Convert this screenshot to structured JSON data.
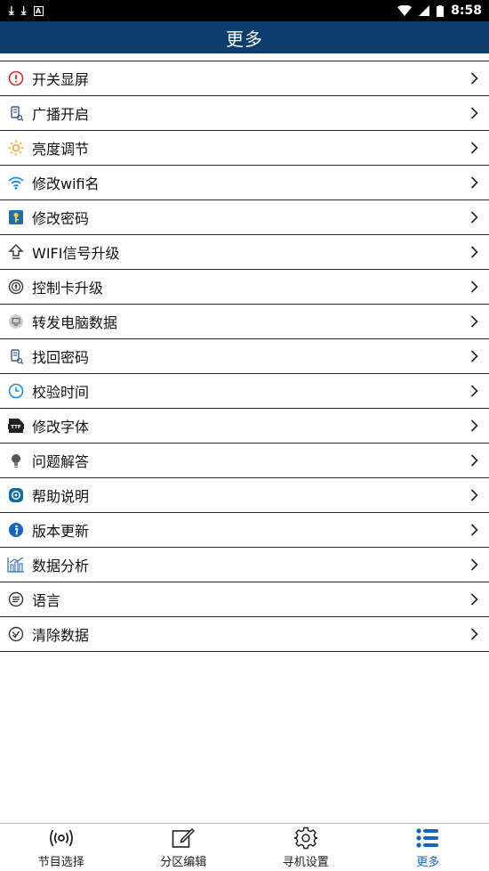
{
  "status_bar": {
    "time": "8:58"
  },
  "header": {
    "title": "更多"
  },
  "menu": {
    "items": [
      {
        "label": "开关显屏",
        "icon": "power-icon"
      },
      {
        "label": "广播开启",
        "icon": "broadcast-icon"
      },
      {
        "label": "亮度调节",
        "icon": "brightness-icon"
      },
      {
        "label": "修改wifi名",
        "icon": "wifi-icon"
      },
      {
        "label": "修改密码",
        "icon": "key-icon"
      },
      {
        "label": "WIFI信号升级",
        "icon": "upgrade-arrow-icon"
      },
      {
        "label": "控制卡升级",
        "icon": "control-card-icon"
      },
      {
        "label": "转发电脑数据",
        "icon": "computer-data-icon"
      },
      {
        "label": "找回密码",
        "icon": "find-password-icon"
      },
      {
        "label": "校验时间",
        "icon": "clock-icon"
      },
      {
        "label": "修改字体",
        "icon": "font-ttf-icon"
      },
      {
        "label": "问题解答",
        "icon": "lightbulb-icon"
      },
      {
        "label": "帮助说明",
        "icon": "help-icon"
      },
      {
        "label": "版本更新",
        "icon": "info-icon"
      },
      {
        "label": "数据分析",
        "icon": "chart-icon"
      },
      {
        "label": "语言",
        "icon": "language-icon"
      },
      {
        "label": "清除数据",
        "icon": "clear-data-icon"
      }
    ]
  },
  "bottom_nav": {
    "items": [
      {
        "label": "节目选择",
        "icon": "broadcast-signal-icon"
      },
      {
        "label": "分区编辑",
        "icon": "edit-icon"
      },
      {
        "label": "寻机设置",
        "icon": "gear-icon"
      },
      {
        "label": "更多",
        "icon": "list-icon",
        "active": true
      }
    ]
  },
  "colors": {
    "header_bg": "#0b3d6e",
    "active_nav": "#1565c0",
    "power_red": "#d32f2f",
    "sun_orange": "#f5a623",
    "wifi_blue": "#1e88e5"
  }
}
